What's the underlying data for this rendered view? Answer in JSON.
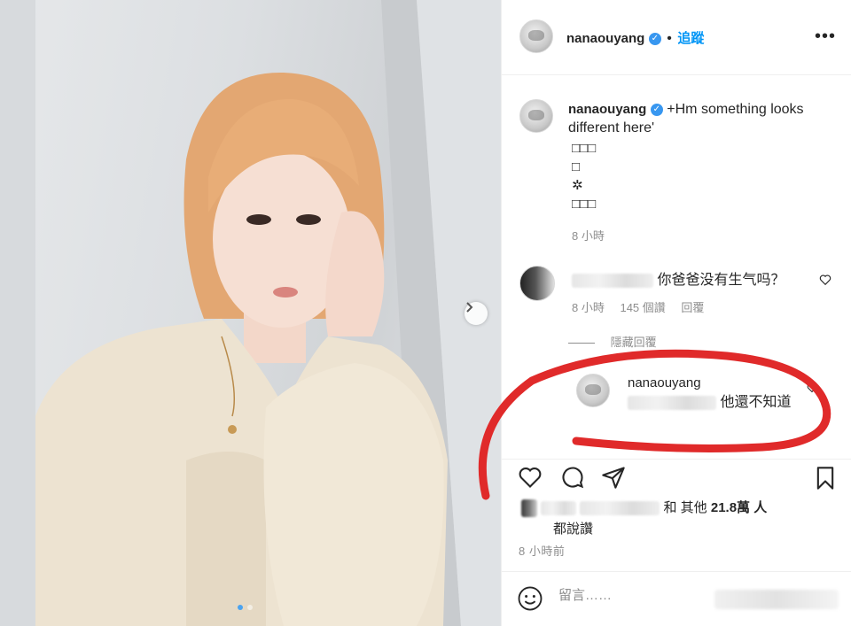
{
  "post": {
    "username": "nanaouyang",
    "verified_icon": "verified-badge-icon",
    "follow_label": "追蹤",
    "more_icon": "more-options-icon",
    "more_label": "•••"
  },
  "caption": {
    "username": "nanaouyang",
    "text": "+Hm something looks different here'",
    "lines": [
      "□□□",
      "□",
      "✲",
      "□□□"
    ],
    "time": "8 小時"
  },
  "comments": [
    {
      "text": "你爸爸没有生气吗？",
      "time": "8 小時",
      "likes": "145 個讚",
      "reply_label": "回覆"
    }
  ],
  "hidden_replies_label": "隱藏回覆",
  "reply": {
    "username": "nanaouyang",
    "text": "他還不知道"
  },
  "likes": {
    "suffix": "和 其他",
    "count": "21.8萬",
    "unit": "人",
    "line2": "都說讚"
  },
  "post_time": "8 小時前",
  "comment_box": {
    "placeholder": "留言……"
  },
  "colors": {
    "accent": "#0095f6",
    "verified": "#3897f0",
    "annotation": "#e02a2a",
    "carousel_active": "#4aa3f0"
  },
  "carousel": {
    "count": 2,
    "active_index": 0
  }
}
